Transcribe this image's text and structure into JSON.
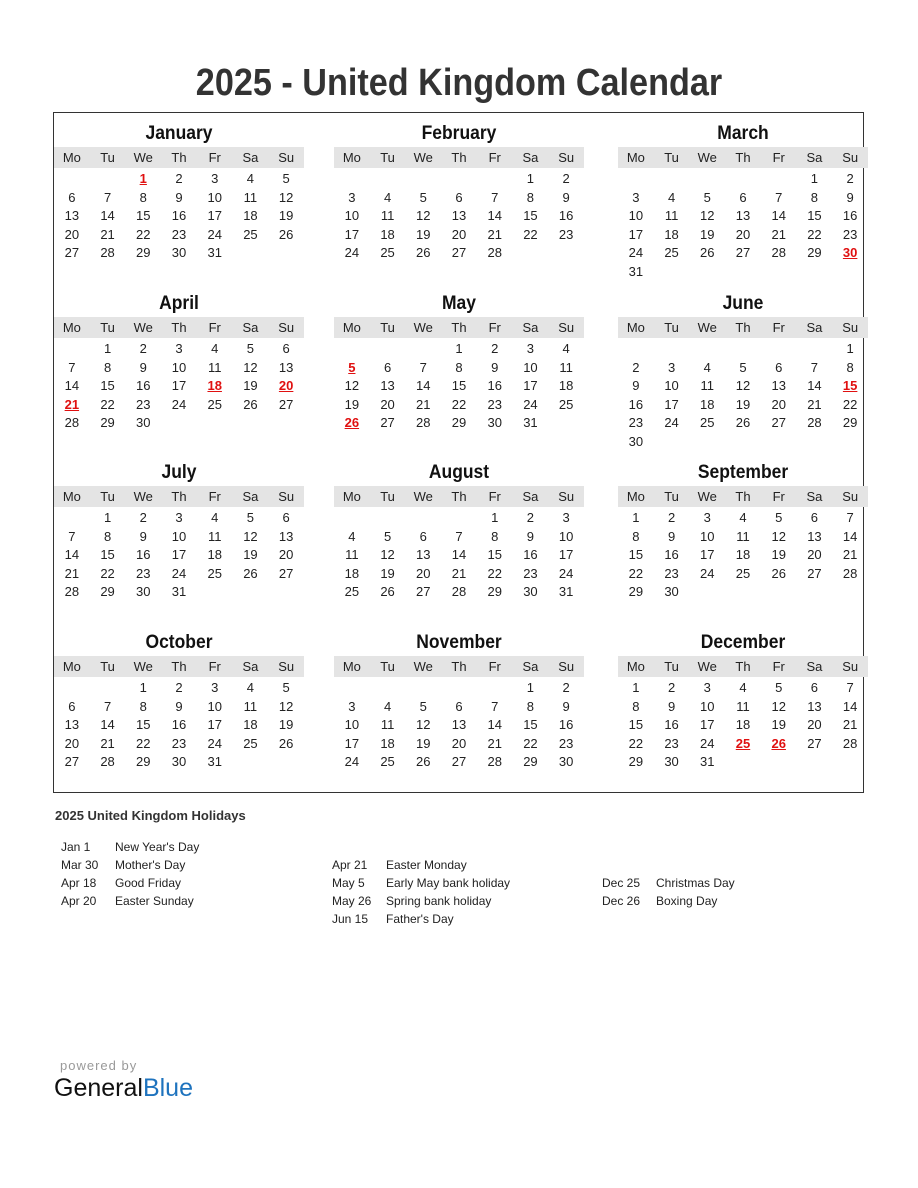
{
  "title": "2025 - United Kingdom Calendar",
  "weekdays": [
    "Mo",
    "Tu",
    "We",
    "Th",
    "Fr",
    "Sa",
    "Su"
  ],
  "months": [
    {
      "name": "January",
      "offset": 2,
      "days": 31,
      "holidays": [
        1
      ]
    },
    {
      "name": "February",
      "offset": 5,
      "days": 28,
      "holidays": []
    },
    {
      "name": "March",
      "offset": 5,
      "days": 31,
      "holidays": [
        30
      ]
    },
    {
      "name": "April",
      "offset": 1,
      "days": 30,
      "holidays": [
        18,
        20,
        21
      ]
    },
    {
      "name": "May",
      "offset": 3,
      "days": 31,
      "holidays": [
        5,
        26
      ]
    },
    {
      "name": "June",
      "offset": 6,
      "days": 30,
      "holidays": [
        15
      ]
    },
    {
      "name": "July",
      "offset": 1,
      "days": 31,
      "holidays": []
    },
    {
      "name": "August",
      "offset": 4,
      "days": 31,
      "holidays": []
    },
    {
      "name": "September",
      "offset": 0,
      "days": 30,
      "holidays": []
    },
    {
      "name": "October",
      "offset": 2,
      "days": 31,
      "holidays": []
    },
    {
      "name": "November",
      "offset": 5,
      "days": 30,
      "holidays": []
    },
    {
      "name": "December",
      "offset": 0,
      "days": 31,
      "holidays": [
        25,
        26
      ]
    }
  ],
  "holidays_title": "2025 United Kingdom Holidays",
  "holiday_columns": [
    [
      {
        "date": "Jan 1",
        "name": "New Year's Day"
      },
      {
        "date": "Mar 30",
        "name": "Mother's Day"
      },
      {
        "date": "Apr 18",
        "name": "Good Friday"
      },
      {
        "date": "Apr 20",
        "name": "Easter Sunday"
      }
    ],
    [
      {
        "date": "Apr 21",
        "name": "Easter Monday"
      },
      {
        "date": "May 5",
        "name": "Early May bank holiday"
      },
      {
        "date": "May 26",
        "name": "Spring bank holiday"
      },
      {
        "date": "Jun 15",
        "name": "Father's Day"
      }
    ],
    [
      {
        "date": "Dec 25",
        "name": "Christmas Day"
      },
      {
        "date": "Dec 26",
        "name": "Boxing Day"
      }
    ]
  ],
  "footer": {
    "powered_by": "powered by",
    "brand_a": "General",
    "brand_b": "Blue"
  },
  "colors": {
    "holiday": "#e01010",
    "header_bg": "#e4e4e4",
    "brand_blue": "#1e73be"
  }
}
